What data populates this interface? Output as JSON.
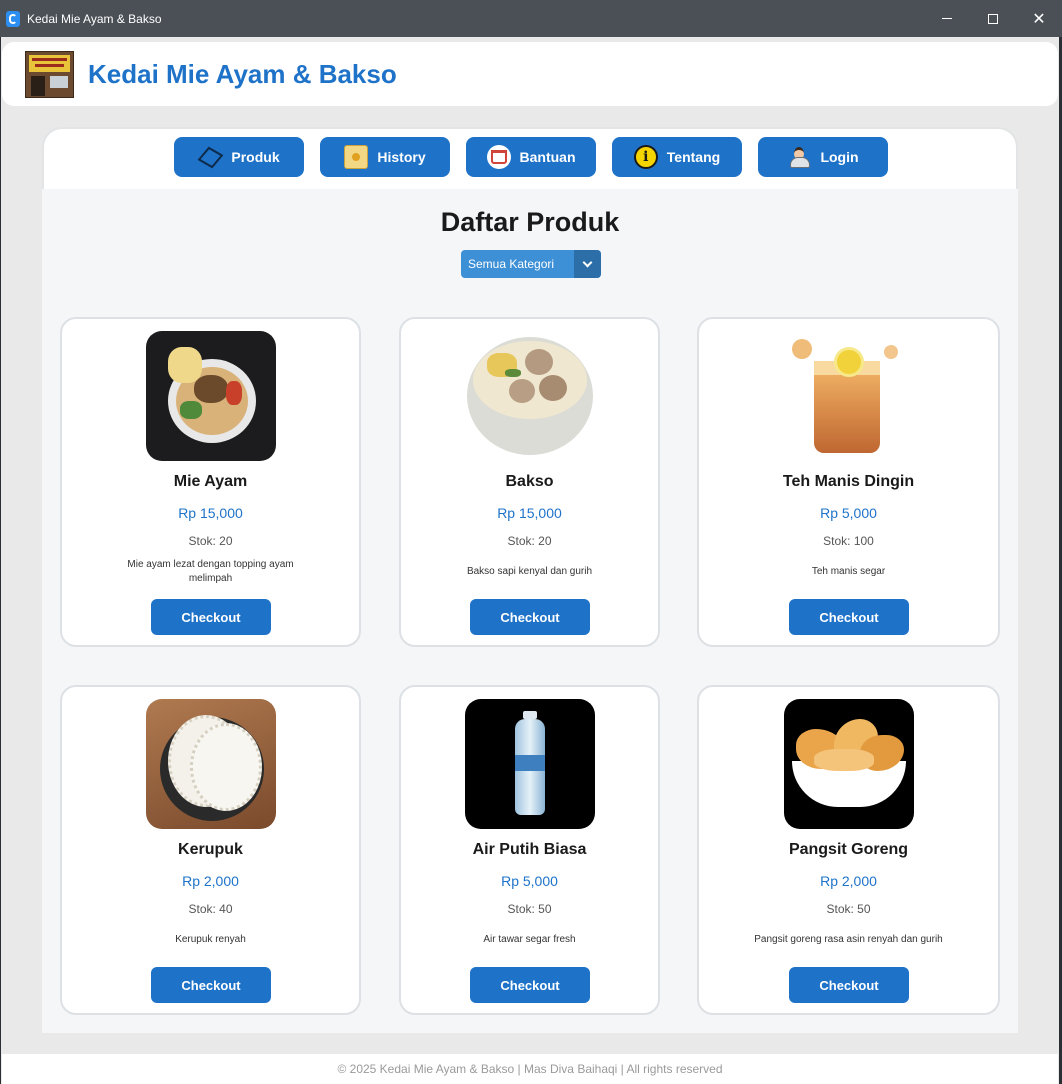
{
  "window": {
    "title": "Kedai Mie Ayam & Bakso",
    "controls": [
      "minimize",
      "maximize",
      "close"
    ]
  },
  "header": {
    "brand": "Kedai Mie Ayam & Bakso"
  },
  "nav": [
    {
      "label": "Produk",
      "icon": "box-icon"
    },
    {
      "label": "History",
      "icon": "scroll-icon"
    },
    {
      "label": "Bantuan",
      "icon": "cart-icon"
    },
    {
      "label": "Tentang",
      "icon": "info-icon"
    },
    {
      "label": "Login",
      "icon": "user-icon"
    }
  ],
  "main": {
    "title": "Daftar Produk",
    "category_select": {
      "value": "Semua Kategori"
    }
  },
  "products": [
    {
      "name": "Mie Ayam",
      "price": "Rp 15,000",
      "stock": "Stok: 20",
      "description": "Mie ayam lezat dengan topping ayam melimpah",
      "button": "Checkout",
      "image": "mie-ayam-photo"
    },
    {
      "name": "Bakso",
      "price": "Rp 15,000",
      "stock": "Stok: 20",
      "description": "Bakso sapi kenyal dan gurih",
      "button": "Checkout",
      "image": "bakso-photo"
    },
    {
      "name": "Teh Manis Dingin",
      "price": "Rp 5,000",
      "stock": "Stok: 100",
      "description": "Teh manis segar",
      "button": "Checkout",
      "image": "iced-tea-photo"
    },
    {
      "name": "Kerupuk",
      "price": "Rp 2,000",
      "stock": "Stok: 40",
      "description": "Kerupuk renyah",
      "button": "Checkout",
      "image": "kerupuk-photo"
    },
    {
      "name": "Air Putih Biasa",
      "price": "Rp 5,000",
      "stock": "Stok: 50",
      "description": "Air tawar segar fresh",
      "button": "Checkout",
      "image": "water-bottle-photo"
    },
    {
      "name": "Pangsit Goreng",
      "price": "Rp 2,000",
      "stock": "Stok: 50",
      "description": "Pangsit goreng rasa asin renyah dan gurih",
      "button": "Checkout",
      "image": "pangsit-photo"
    }
  ],
  "footer": {
    "text": "© 2025 Kedai Mie Ayam & Bakso | Mas Diva Baihaqi | All rights reserved"
  },
  "colors": {
    "accent": "#1e73c9",
    "titlebar": "#4b5056",
    "content_bg": "#f4f6f8"
  }
}
